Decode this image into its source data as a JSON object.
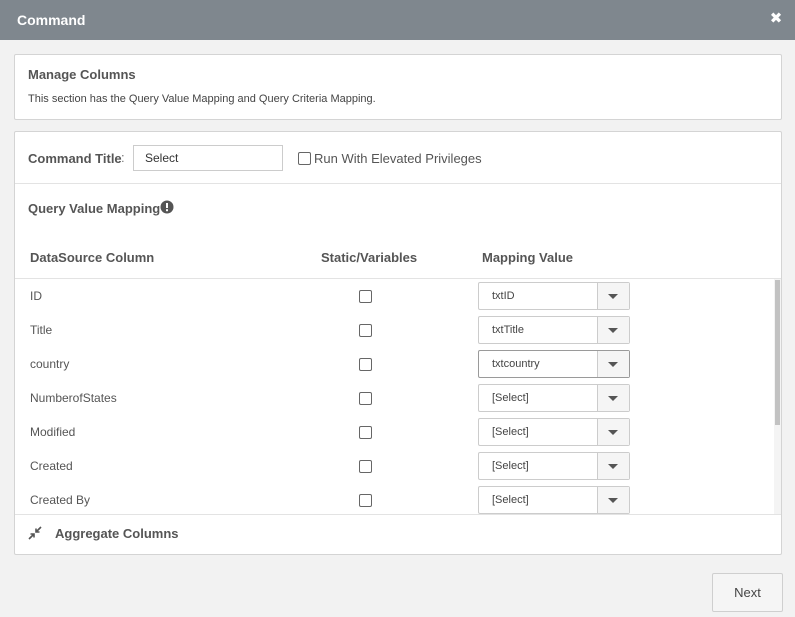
{
  "dialog": {
    "title": "Command",
    "close_glyph": "✖"
  },
  "manage_columns": {
    "heading": "Manage Columns",
    "description": "This section has the Query Value Mapping and Query Criteria Mapping."
  },
  "command": {
    "title_label": "Command Title",
    "title_colon": ":",
    "title_value": "Select",
    "elevated_label": "Run With Elevated Privileges",
    "elevated_checked": false
  },
  "query_value_mapping": {
    "heading": "Query Value Mapping",
    "info_icon": "exclamation-circle-icon",
    "columns": {
      "datasource": "DataSource Column",
      "static": "Static/Variables",
      "mapping": "Mapping Value"
    },
    "rows": [
      {
        "name": "ID",
        "static": false,
        "mapping": "txtID"
      },
      {
        "name": "Title",
        "static": false,
        "mapping": "txtTitle"
      },
      {
        "name": "country",
        "static": false,
        "mapping": "txtcountry"
      },
      {
        "name": "NumberofStates",
        "static": false,
        "mapping": "[Select]"
      },
      {
        "name": "Modified",
        "static": false,
        "mapping": "[Select]"
      },
      {
        "name": "Created",
        "static": false,
        "mapping": "[Select]"
      },
      {
        "name": "Created By",
        "static": false,
        "mapping": "[Select]"
      }
    ]
  },
  "aggregate": {
    "label": "Aggregate Columns",
    "icon": "collapse-arrows-icon"
  },
  "footer": {
    "next_label": "Next"
  },
  "colors": {
    "titlebar": "#7f878e",
    "panel_border": "#d4d4d4",
    "page_bg": "#f2f2f2"
  }
}
